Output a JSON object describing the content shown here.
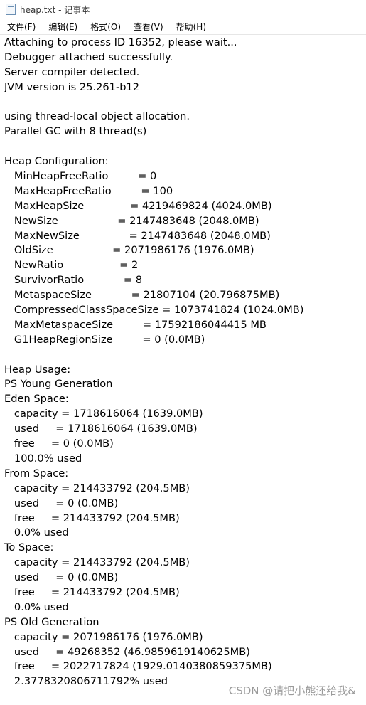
{
  "window": {
    "title": "heap.txt - 记事本",
    "icon": "notepad-icon"
  },
  "menu": [
    {
      "label": "文件(F)"
    },
    {
      "label": "编辑(E)"
    },
    {
      "label": "格式(O)"
    },
    {
      "label": "查看(V)"
    },
    {
      "label": "帮助(H)"
    }
  ],
  "lines": [
    "Attaching to process ID 16352, please wait...",
    "Debugger attached successfully.",
    "Server compiler detected.",
    "JVM version is 25.261-b12",
    "",
    "using thread-local object allocation.",
    "Parallel GC with 8 thread(s)",
    "",
    "Heap Configuration:",
    "   MinHeapFreeRatio         = 0",
    "   MaxHeapFreeRatio         = 100",
    "   MaxHeapSize              = 4219469824 (4024.0MB)",
    "   NewSize                  = 2147483648 (2048.0MB)",
    "   MaxNewSize               = 2147483648 (2048.0MB)",
    "   OldSize                  = 2071986176 (1976.0MB)",
    "   NewRatio                 = 2",
    "   SurvivorRatio            = 8",
    "   MetaspaceSize            = 21807104 (20.796875MB)",
    "   CompressedClassSpaceSize = 1073741824 (1024.0MB)",
    "   MaxMetaspaceSize         = 17592186044415 MB",
    "   G1HeapRegionSize         = 0 (0.0MB)",
    "",
    "Heap Usage:",
    "PS Young Generation",
    "Eden Space:",
    "   capacity = 1718616064 (1639.0MB)",
    "   used     = 1718616064 (1639.0MB)",
    "   free     = 0 (0.0MB)",
    "   100.0% used",
    "From Space:",
    "   capacity = 214433792 (204.5MB)",
    "   used     = 0 (0.0MB)",
    "   free     = 214433792 (204.5MB)",
    "   0.0% used",
    "To Space:",
    "   capacity = 214433792 (204.5MB)",
    "   used     = 0 (0.0MB)",
    "   free     = 214433792 (204.5MB)",
    "   0.0% used",
    "PS Old Generation",
    "   capacity = 2071986176 (1976.0MB)",
    "   used     = 49268352 (46.9859619140625MB)",
    "   free     = 2022717824 (1929.0140380859375MB)",
    "   2.3778320806711792% used"
  ],
  "watermark": "CSDN @请把小熊还给我&"
}
